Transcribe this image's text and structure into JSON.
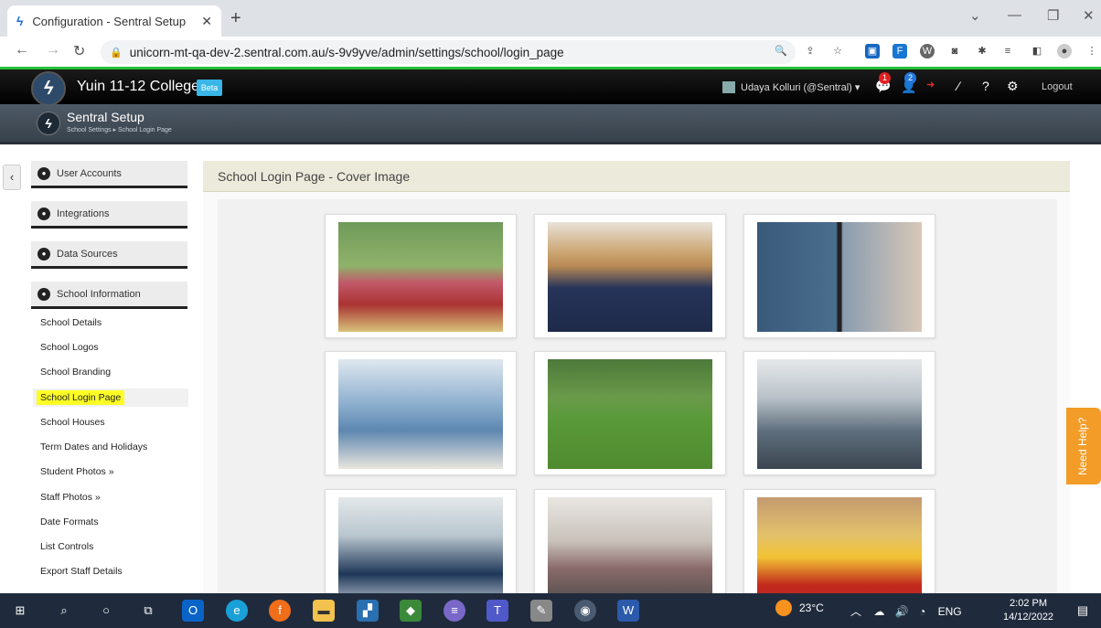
{
  "browser": {
    "tab_title": "Configuration - Sentral Setup",
    "url": "unicorn-mt-qa-dev-2.sentral.com.au/s-9v9yve/admin/settings/school/login_page"
  },
  "header": {
    "college": "Yuin 11-12 College",
    "beta": "Beta",
    "user": "Udaya Kolluri (@Sentral) ▾",
    "messages_count": "1",
    "notifications_count": "2",
    "logout": "Logout"
  },
  "subheader": {
    "title": "Sentral Setup",
    "breadcrumb": "School Settings ▸ School Login Page"
  },
  "sidebar": {
    "sections": [
      {
        "label": "User Accounts"
      },
      {
        "label": "Integrations"
      },
      {
        "label": "Data Sources"
      },
      {
        "label": "School Information"
      }
    ],
    "items": [
      {
        "label": "School Details"
      },
      {
        "label": "School Logos"
      },
      {
        "label": "School Branding"
      },
      {
        "label": "School Login Page"
      },
      {
        "label": "School Houses"
      },
      {
        "label": "Term Dates and Holidays"
      },
      {
        "label": "Student Photos »"
      },
      {
        "label": "Staff Photos »"
      },
      {
        "label": "Date Formats"
      },
      {
        "label": "List Controls"
      },
      {
        "label": "Export Staff Details"
      }
    ]
  },
  "main": {
    "panel_title": "School Login Page - Cover Image"
  },
  "help": {
    "label": "Need Help?"
  },
  "taskbar": {
    "temperature": "23°C",
    "language": "ENG",
    "time": "2:02 PM",
    "date": "14/12/2022"
  },
  "colors": {
    "accent_green": "#23c13a",
    "highlight_yellow": "#fdfd26",
    "help_orange": "#f39c27"
  }
}
